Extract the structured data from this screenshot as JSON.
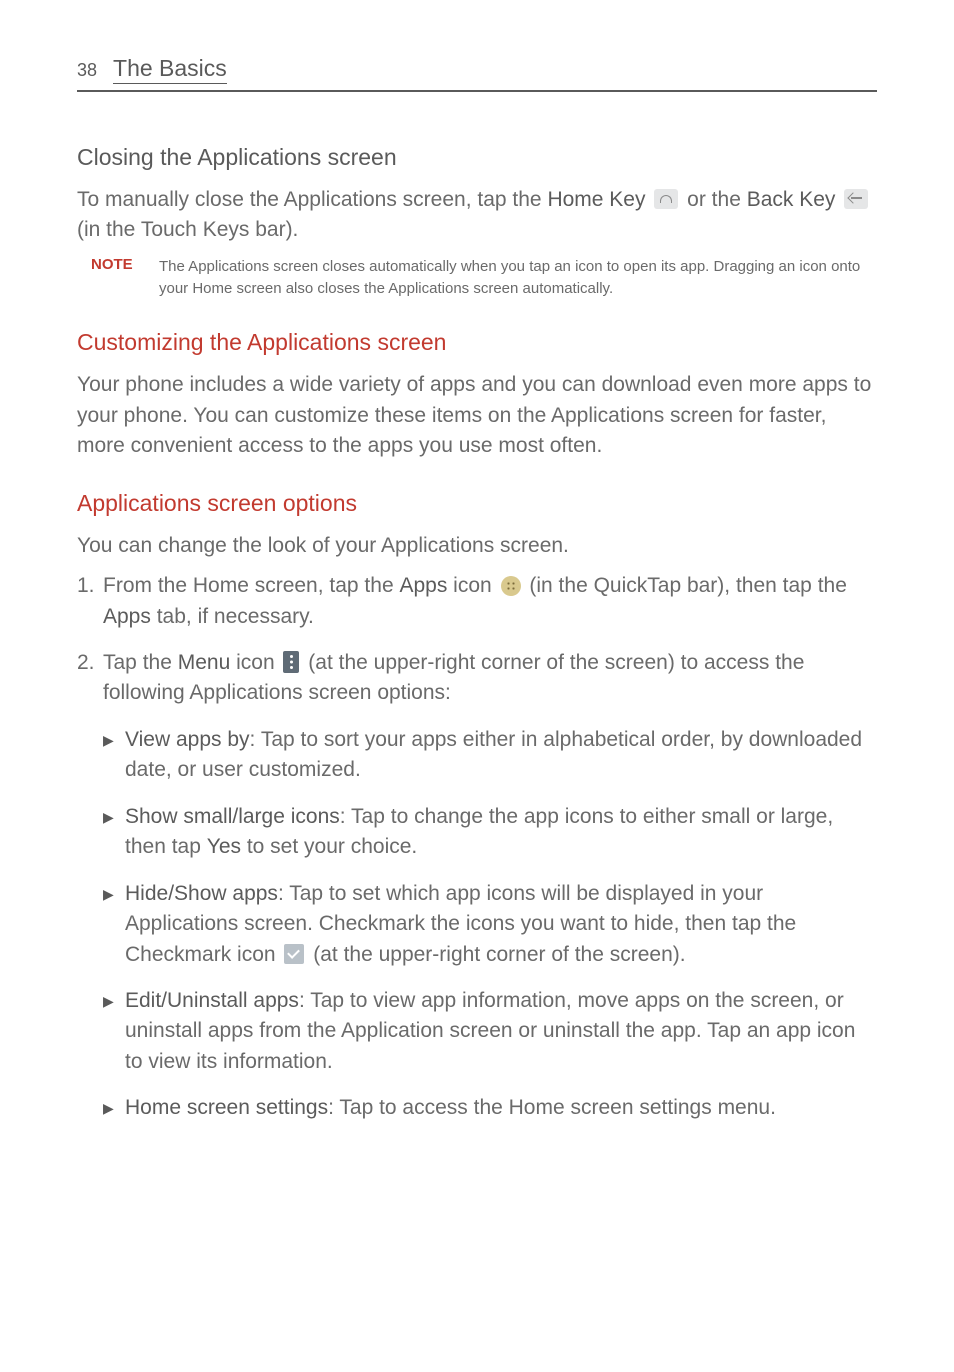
{
  "header": {
    "page_number": "38",
    "title": "The Basics"
  },
  "section_close": {
    "heading": "Closing the Applications screen",
    "p1a": "To manually close the Applications screen, tap the ",
    "home_key": "Home Key",
    "p1b": " or the ",
    "back_key": "Back Key",
    "p1c": " (in the Touch Keys bar).",
    "note_label": "NOTE",
    "note_text": "The Applications screen closes automatically when you tap an icon to open its app. Dragging an icon onto your Home screen also closes the Applications screen automatically."
  },
  "section_custom": {
    "heading": "Customizing the Applications screen",
    "p": "Your phone includes a wide variety of apps and you can download even more apps to your phone. You can customize these items on the Applications screen for faster, more convenient access to the apps you use most often."
  },
  "section_options": {
    "heading": "Applications screen options",
    "p": "You can change the look of your Applications screen.",
    "step1": {
      "num": "1.",
      "a": "From the Home screen, tap the ",
      "apps": "Apps",
      "b": " icon ",
      "c": " (in the QuickTap bar), then tap the ",
      "apps_tab": "Apps",
      "d": " tab, if necessary."
    },
    "step2": {
      "num": "2.",
      "a": "Tap the ",
      "menu": "Menu",
      "b": " icon ",
      "c": " (at the upper-right corner of the screen) to access the following Applications screen options:"
    },
    "bullets": {
      "b1": {
        "title": "View apps by",
        "text": ": Tap to sort your apps either in alphabetical order, by downloaded date, or user customized."
      },
      "b2": {
        "title": "Show small/large icons",
        "text_a": ": Tap to change the app icons to either small or large, then tap ",
        "yes": "Yes",
        "text_b": " to set your choice."
      },
      "b3": {
        "title": "Hide/Show apps",
        "text_a": ": Tap to set which app icons will be displayed in your Applications screen. Checkmark the icons you want to hide, then tap the Checkmark icon ",
        "text_b": " (at the upper-right corner of the screen)."
      },
      "b4": {
        "title": "Edit/Uninstall apps",
        "text": ": Tap to view app information, move apps on the screen, or uninstall apps from the Application screen or uninstall the app. Tap an app icon to view its information."
      },
      "b5": {
        "title": "Home screen settings",
        "text": ": Tap to access the Home screen settings menu."
      }
    }
  }
}
